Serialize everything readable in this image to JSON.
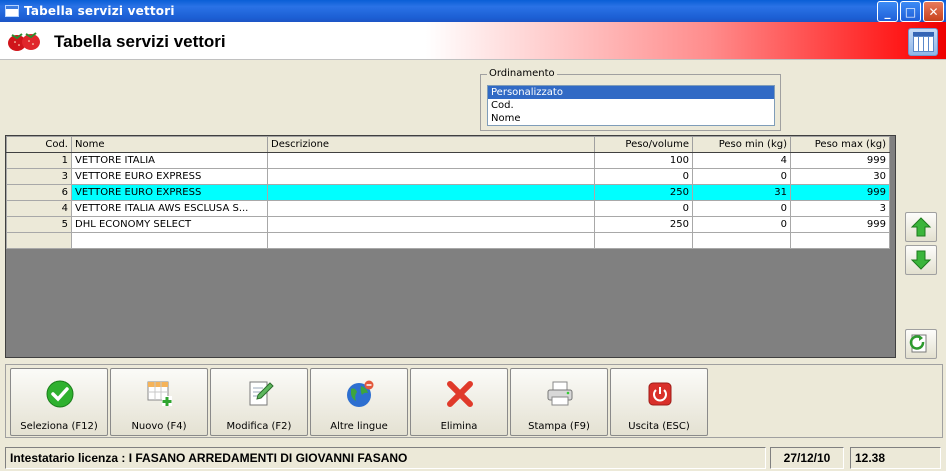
{
  "window": {
    "title": "Tabella servizi vettori",
    "buttons": {
      "minimize": "_",
      "maximize": "□",
      "close": "✕"
    }
  },
  "header": {
    "title": "Tabella servizi vettori"
  },
  "ordinamento": {
    "legend": "Ordinamento",
    "options": [
      "Personalizzato",
      "Cod.",
      "Nome"
    ],
    "selected": "Personalizzato"
  },
  "table": {
    "columns": [
      "Cod.",
      "Nome",
      "Descrizione",
      "Peso/volume",
      "Peso min (kg)",
      "Peso max (kg)"
    ],
    "rows": [
      {
        "cod": "1",
        "nome": "VETTORE ITALIA",
        "descrizione": "",
        "peso_volume": "100",
        "peso_min": "4",
        "peso_max": "999"
      },
      {
        "cod": "3",
        "nome": "VETTORE EURO EXPRESS",
        "descrizione": "",
        "peso_volume": "0",
        "peso_min": "0",
        "peso_max": "30"
      },
      {
        "cod": "6",
        "nome": "VETTORE EURO EXPRESS",
        "descrizione": "",
        "peso_volume": "250",
        "peso_min": "31",
        "peso_max": "999"
      },
      {
        "cod": "4",
        "nome": "VETTORE ITALIA AWS ESCLUSA S...",
        "descrizione": "",
        "peso_volume": "0",
        "peso_min": "0",
        "peso_max": "3"
      },
      {
        "cod": "5",
        "nome": "DHL ECONOMY SELECT",
        "descrizione": "",
        "peso_volume": "250",
        "peso_min": "0",
        "peso_max": "999"
      }
    ],
    "highlight_color": "#00ffff"
  },
  "toolbar": {
    "seleziona": "Seleziona (F12)",
    "nuovo": "Nuovo (F4)",
    "modifica": "Modifica (F2)",
    "altre_lingue": "Altre lingue",
    "elimina": "Elimina",
    "stampa": "Stampa (F9)",
    "uscita": "Uscita (ESC)"
  },
  "status": {
    "license": "Intestatario licenza : I FASANO ARREDAMENTI DI GIOVANNI FASANO",
    "date": "27/12/10",
    "time": "12.38"
  },
  "icons": {
    "seleziona": "checkmark-icon",
    "nuovo": "new-grid-icon",
    "modifica": "edit-document-icon",
    "altre_lingue": "globe-icon",
    "elimina": "red-x-icon",
    "stampa": "printer-icon",
    "uscita": "power-icon",
    "move_up": "arrow-up-icon",
    "move_down": "arrow-down-icon",
    "refresh": "refresh-icon"
  }
}
